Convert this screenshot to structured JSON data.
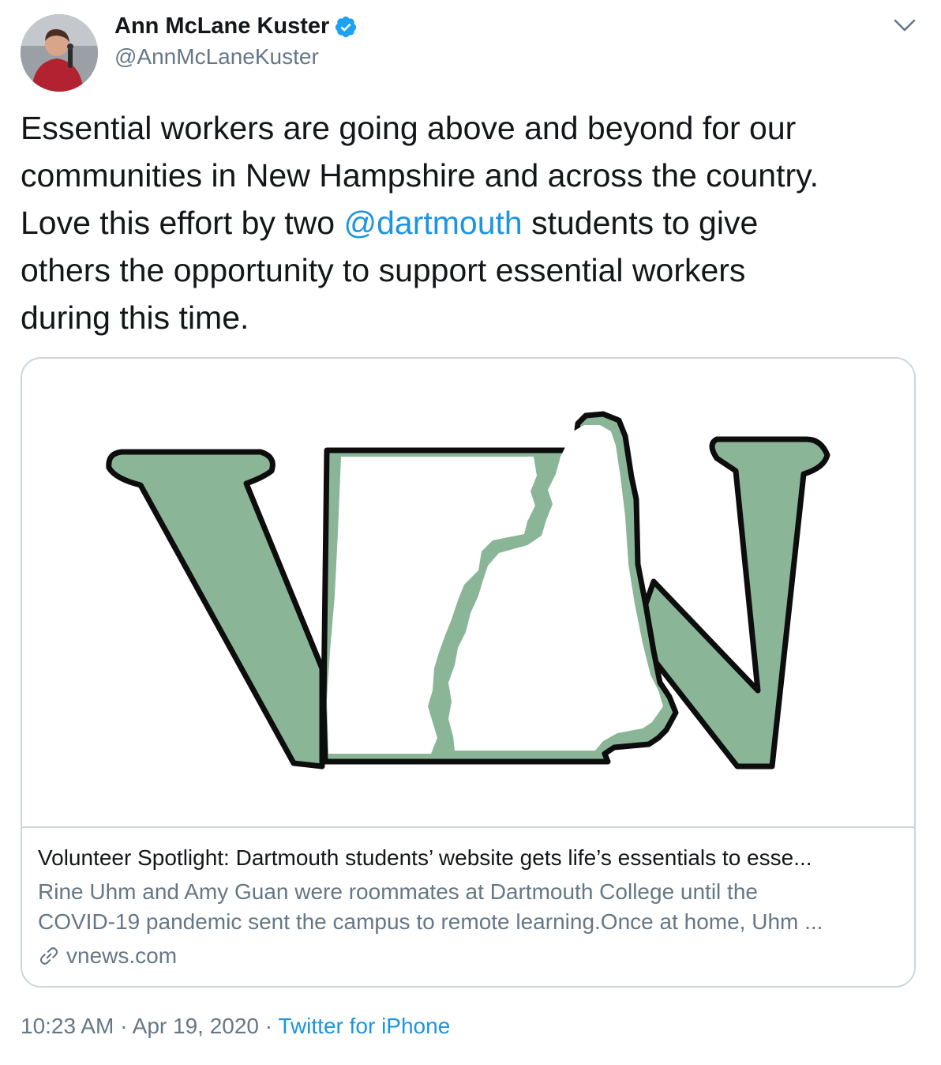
{
  "author": {
    "name": "Ann McLane Kuster",
    "handle": "@AnnMcLaneKuster",
    "verified": true,
    "verified_color": "#1da1f2"
  },
  "tweet": {
    "text_line1": "Essential workers are going above and beyond for our",
    "text_line2": "communities in New Hampshire and across the country.",
    "text_line3_before": "Love this effort by two ",
    "mention": "@dartmouth",
    "text_line3_after": " students to give",
    "text_line4": "others the opportunity to support essential workers",
    "text_line5": "during this time."
  },
  "card": {
    "image_icon": "vn-logo",
    "logo_fill": "#8ab597",
    "title": "Volunteer Spotlight: Dartmouth students’ website gets life’s essentials to esse...",
    "description_line1": "Rine Uhm and Amy Guan were roommates at Dartmouth College until the",
    "description_line2": "COVID-19 pandemic sent the campus to remote learning.Once at home, Uhm ...",
    "domain": "vnews.com",
    "domain_icon": "link-icon"
  },
  "meta": {
    "time": "10:23 AM",
    "separator1": " · ",
    "date": "Apr 19, 2020",
    "separator2": " · ",
    "source": "Twitter for iPhone"
  },
  "colors": {
    "text": "#14171a",
    "secondary": "#657786",
    "link": "#1b95e0",
    "border": "#ccd6dd"
  }
}
